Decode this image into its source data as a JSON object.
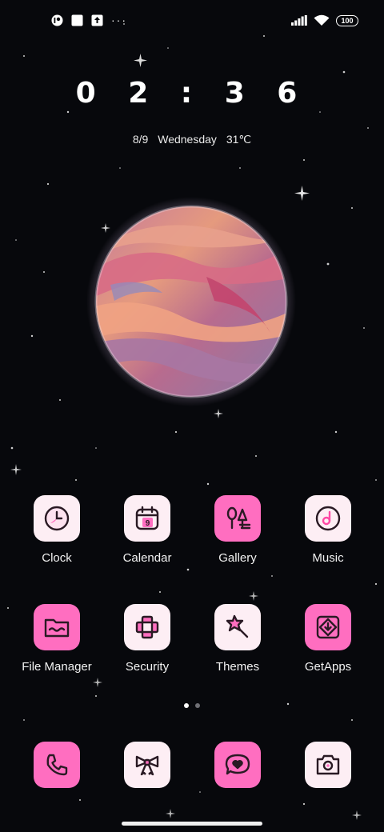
{
  "status_bar": {
    "battery": "100",
    "left_icons": [
      "app-notification-icon",
      "square-notification-icon",
      "upload-notification-icon"
    ],
    "overflow": "···",
    "right_icons": [
      "signal-icon",
      "wifi-icon",
      "battery-icon"
    ]
  },
  "clock": {
    "time": "0 2 : 3 6"
  },
  "date": {
    "day": "8/9",
    "weekday": "Wednesday",
    "temperature": "31℃"
  },
  "apps_row1": [
    {
      "label": "Clock",
      "icon": "clock-icon"
    },
    {
      "label": "Calendar",
      "icon": "calendar-icon",
      "badge": "9"
    },
    {
      "label": "Gallery",
      "icon": "gallery-icon"
    },
    {
      "label": "Music",
      "icon": "music-icon"
    }
  ],
  "apps_row2": [
    {
      "label": "File Manager",
      "icon": "folder-icon"
    },
    {
      "label": "Security",
      "icon": "security-icon"
    },
    {
      "label": "Themes",
      "icon": "themes-icon"
    },
    {
      "label": "GetApps",
      "icon": "getapps-icon"
    }
  ],
  "dock": [
    {
      "icon": "phone-icon"
    },
    {
      "icon": "bow-icon"
    },
    {
      "icon": "message-heart-icon"
    },
    {
      "icon": "camera-icon"
    }
  ],
  "pager": {
    "pages": 2,
    "active": 1
  },
  "colors": {
    "pink": "#ff6ec0",
    "tile_light": "#fdeef4",
    "icon_stroke": "#2a1a24"
  }
}
